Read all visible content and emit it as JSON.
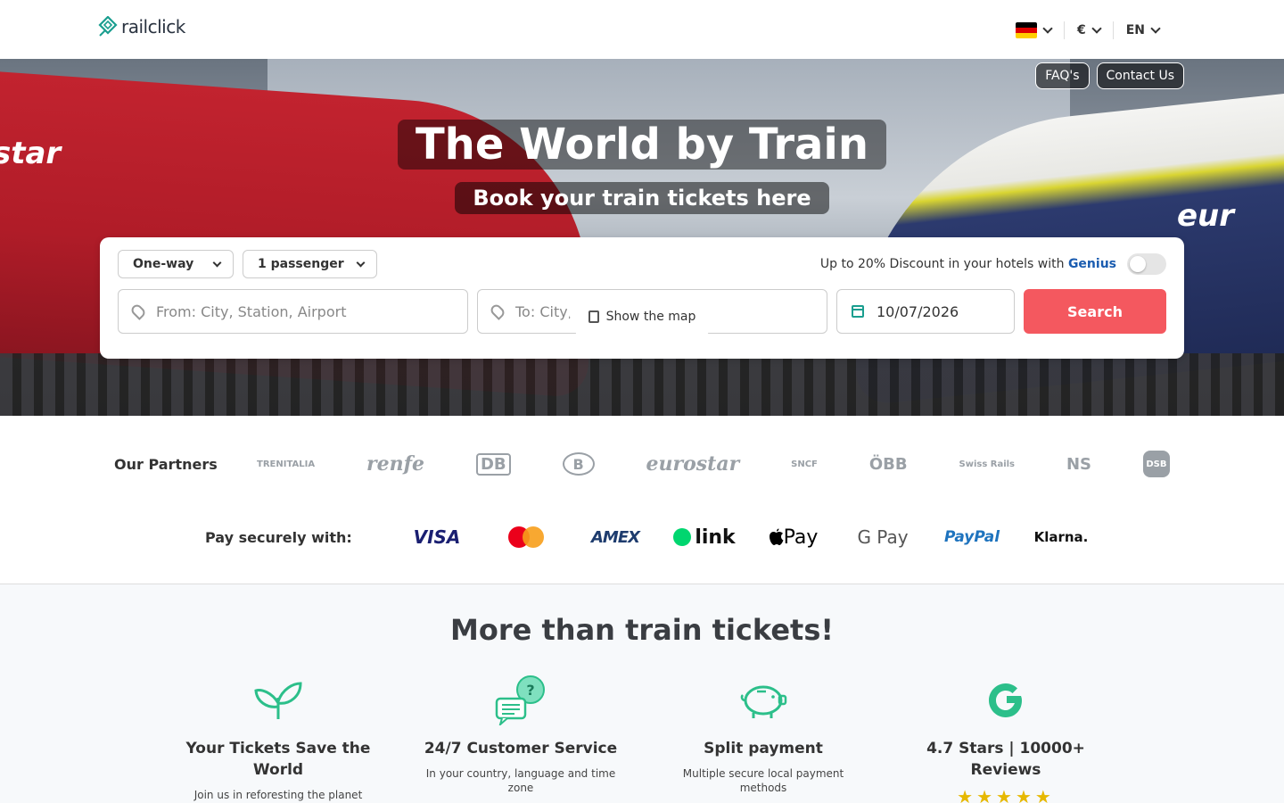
{
  "header": {
    "logo_text": "railclick",
    "language_flag": "de",
    "currency": "€",
    "language": "EN"
  },
  "hero": {
    "links": {
      "faq": "FAQ's",
      "contact": "Contact Us"
    },
    "title": "The World by Train",
    "subtitle": "Book your train tickets here",
    "train_left_text": "star",
    "train_right_text": "eur"
  },
  "search": {
    "trip_type": "One-way",
    "passengers": "1 passenger",
    "genius_text": "Up to 20% Discount in your hotels with",
    "genius_brand": "Genius",
    "from_placeholder": "From: City, Station, Airport",
    "to_placeholder": "To: City, Station, Airport",
    "date_value": "10/07/2026",
    "search_label": "Search",
    "map_label": "Show the map"
  },
  "partners": {
    "label": "Our Partners",
    "logos": [
      "TRENITALIA",
      "renfe",
      "DB",
      "B",
      "eurostar",
      "SNCF",
      "ÖBB",
      "Swiss Rails",
      "NS",
      "DSB"
    ]
  },
  "payments": {
    "label": "Pay securely with:",
    "methods": [
      "VISA",
      "Mastercard",
      "AMEX",
      "link",
      "Pay",
      "G Pay",
      "PayPal",
      "Klarna."
    ]
  },
  "more": {
    "title": "More than train tickets!",
    "features": [
      {
        "icon": "leaf-icon",
        "title": "Your Tickets Save the World",
        "desc": "Join us in reforesting the planet"
      },
      {
        "icon": "chat-support-icon",
        "title": "24/7 Customer Service",
        "desc": "In your country, language and time zone"
      },
      {
        "icon": "piggy-bank-icon",
        "title": "Split payment",
        "desc": "Multiple secure local payment methods"
      },
      {
        "icon": "google-icon",
        "title": "4.7 Stars | 10000+ Reviews",
        "stars": "★★★★★"
      }
    ]
  },
  "colors": {
    "accent": "#f4585f",
    "brand_teal": "#1a9e8f",
    "feature_green": "#2cbf8a"
  }
}
